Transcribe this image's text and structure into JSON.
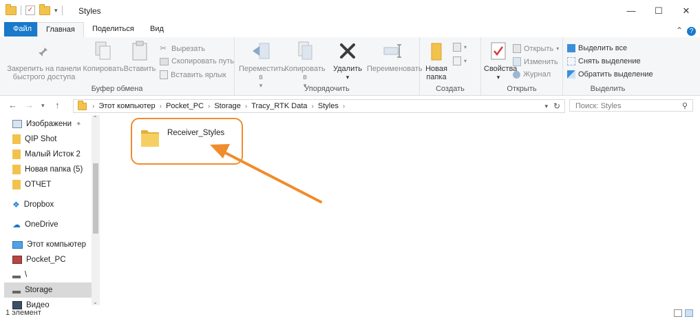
{
  "window": {
    "title": "Styles",
    "minimize": "—",
    "maximize": "☐",
    "close": "✕"
  },
  "tabs": [
    {
      "label": "Файл"
    },
    {
      "label": "Главная"
    },
    {
      "label": "Поделиться"
    },
    {
      "label": "Вид"
    }
  ],
  "ribbon": {
    "clipboard": {
      "pin_label": "Закрепить на панели быстрого доступа",
      "copy_label": "Копировать",
      "paste_label": "Вставить",
      "cut_label": "Вырезать",
      "copy_path_label": "Скопировать путь",
      "paste_shortcut_label": "Вставить ярлык",
      "group_label": "Буфер обмена"
    },
    "organize": {
      "move_label": "Переместить в",
      "copyto_label": "Копировать в",
      "delete_label": "Удалить",
      "rename_label": "Переименовать",
      "group_label": "Упорядочить"
    },
    "create": {
      "new_folder_label": "Новая папка",
      "group_label": "Создать"
    },
    "open": {
      "properties_label": "Свойства",
      "open_label": "Открыть",
      "edit_label": "Изменить",
      "history_label": "Журнал",
      "group_label": "Открыть"
    },
    "select": {
      "select_all_label": "Выделить все",
      "select_none_label": "Снять выделение",
      "invert_label": "Обратить выделение",
      "group_label": "Выделить"
    }
  },
  "address": {
    "crumbs": [
      "Этот компьютер",
      "Pocket_PC",
      "Storage",
      "Tracy_RTK Data",
      "Styles"
    ],
    "search_placeholder": "Поиск: Styles"
  },
  "nav": {
    "items": [
      {
        "label": "Изображени"
      },
      {
        "label": "QIP Shot"
      },
      {
        "label": "Малый Исток 2"
      },
      {
        "label": "Новая папка (5)"
      },
      {
        "label": "ОТЧЕТ"
      },
      {
        "label": "Dropbox"
      },
      {
        "label": "OneDrive"
      },
      {
        "label": "Этот компьютер"
      },
      {
        "label": "Pocket_PC"
      },
      {
        "label": "\\"
      },
      {
        "label": "Storage"
      },
      {
        "label": "Видео"
      }
    ]
  },
  "content": {
    "folder_name": "Receiver_Styles"
  },
  "status": {
    "count": "1 элемент"
  },
  "colors": {
    "accent": "#1979ca",
    "highlight": "#f08c2c",
    "folder": "#f3c24c"
  }
}
